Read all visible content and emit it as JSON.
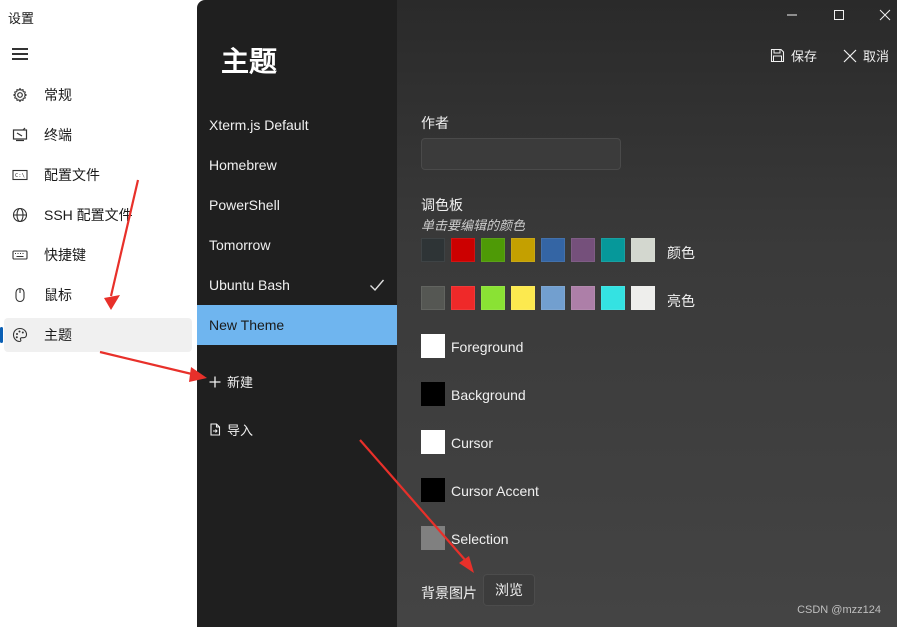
{
  "app": {
    "title": "设置"
  },
  "sidebar": {
    "items": [
      {
        "label": "常规",
        "icon": "gear-icon"
      },
      {
        "label": "终端",
        "icon": "terminal-icon"
      },
      {
        "label": "配置文件",
        "icon": "profile-icon"
      },
      {
        "label": "SSH 配置文件",
        "icon": "globe-icon"
      },
      {
        "label": "快捷键",
        "icon": "keyboard-icon"
      },
      {
        "label": "鼠标",
        "icon": "mouse-icon"
      },
      {
        "label": "主题",
        "icon": "palette-icon",
        "active": true
      }
    ]
  },
  "themes": {
    "title": "主题",
    "items": [
      {
        "label": "Xterm.js Default"
      },
      {
        "label": "Homebrew"
      },
      {
        "label": "PowerShell"
      },
      {
        "label": "Tomorrow"
      },
      {
        "label": "Ubuntu Bash",
        "checked": true
      },
      {
        "label": "New Theme",
        "selected": true
      }
    ],
    "new_label": "新建",
    "import_label": "导入"
  },
  "editor": {
    "save_label": "保存",
    "cancel_label": "取消",
    "author_label": "作者",
    "author_value": "",
    "palette_label": "调色板",
    "palette_hint": "单击要编辑的颜色",
    "normal_label": "颜色",
    "bright_label": "亮色",
    "normal_colors": [
      "#2e3436",
      "#cc0000",
      "#4e9a06",
      "#c4a000",
      "#3465a4",
      "#75507b",
      "#06989a",
      "#d3d7cf"
    ],
    "bright_colors": [
      "#555753",
      "#ef2929",
      "#8ae234",
      "#fce94f",
      "#729fcf",
      "#ad7fa8",
      "#34e2e2",
      "#eeeeec"
    ],
    "special": [
      {
        "label": "Foreground",
        "color": "#ffffff"
      },
      {
        "label": "Background",
        "color": "#000000"
      },
      {
        "label": "Cursor",
        "color": "#ffffff"
      },
      {
        "label": "Cursor Accent",
        "color": "#000000"
      },
      {
        "label": "Selection",
        "color": "#808080"
      }
    ],
    "bg_image_label": "背景图片",
    "browse_label": "浏览"
  },
  "watermark": "CSDN @mzz124",
  "colors": {
    "accent": "#0a5fb4",
    "selected_theme": "#6fb5ef",
    "arrow": "#e8302a"
  }
}
